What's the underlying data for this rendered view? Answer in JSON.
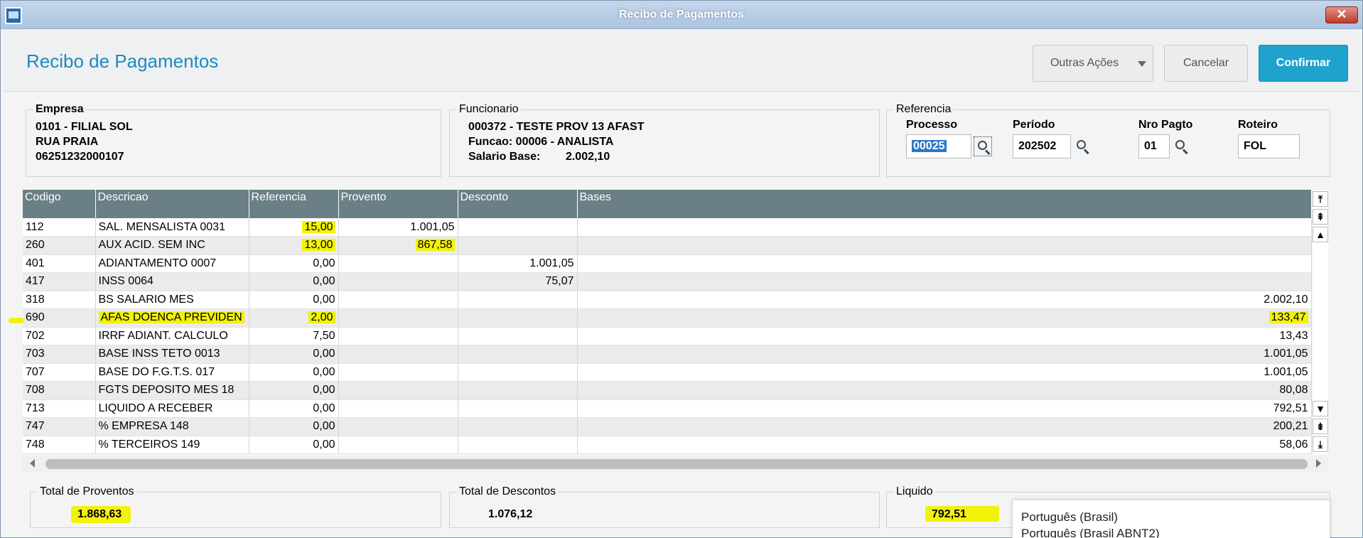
{
  "window": {
    "title": "Recibo de Pagamentos",
    "close_label": "✕"
  },
  "header": {
    "page_title": "Recibo de Pagamentos",
    "outras_label": "Outras Ações",
    "cancel_label": "Cancelar",
    "confirm_label": "Confirmar"
  },
  "empresa": {
    "legend": "Empresa",
    "lines": [
      "0101 - FILIAL SOL",
      "RUA PRAIA",
      "06251232000107"
    ]
  },
  "funcionario": {
    "legend": "Funcionario",
    "lines": [
      "000372 - TESTE PROV 13 AFAST",
      "Funcao: 00006 - ANALISTA",
      "Salario Base:        2.002,10"
    ]
  },
  "referencia": {
    "legend": "Referencia",
    "processo": {
      "label": "Processo",
      "value": "00025"
    },
    "periodo": {
      "label": "Período",
      "value": "202502"
    },
    "nro_pagto": {
      "label": "Nro Pagto",
      "value": "01"
    },
    "roteiro": {
      "label": "Roteiro",
      "value": "FOL"
    }
  },
  "table": {
    "columns": [
      "Codigo",
      "Descricao",
      "Referencia",
      "Provento",
      "Desconto",
      "Bases"
    ],
    "rows": [
      {
        "codigo": "112",
        "descricao": "SAL. MENSALISTA 0031",
        "referencia": "15,00",
        "provento": "1.001,05",
        "desconto": "",
        "bases": ""
      },
      {
        "codigo": "260",
        "descricao": "AUX ACID. SEM INC",
        "referencia": "13,00",
        "provento": "867,58",
        "desconto": "",
        "bases": ""
      },
      {
        "codigo": "401",
        "descricao": "ADIANTAMENTO 0007",
        "referencia": "0,00",
        "provento": "",
        "desconto": "1.001,05",
        "bases": ""
      },
      {
        "codigo": "417",
        "descricao": "INSS 0064",
        "referencia": "0,00",
        "provento": "",
        "desconto": "75,07",
        "bases": ""
      },
      {
        "codigo": "318",
        "descricao": "BS SALARIO MES",
        "referencia": "0,00",
        "provento": "",
        "desconto": "",
        "bases": "2.002,10"
      },
      {
        "codigo": "690",
        "descricao": "AFAS DOENCA PREVIDEN",
        "referencia": "2,00",
        "provento": "",
        "desconto": "",
        "bases": "133,47"
      },
      {
        "codigo": "702",
        "descricao": "IRRF ADIANT. CALCULO",
        "referencia": "7,50",
        "provento": "",
        "desconto": "",
        "bases": "13,43"
      },
      {
        "codigo": "703",
        "descricao": "BASE INSS TETO 0013",
        "referencia": "0,00",
        "provento": "",
        "desconto": "",
        "bases": "1.001,05"
      },
      {
        "codigo": "707",
        "descricao": "BASE DO F.G.T.S. 017",
        "referencia": "0,00",
        "provento": "",
        "desconto": "",
        "bases": "1.001,05"
      },
      {
        "codigo": "708",
        "descricao": "FGTS DEPOSITO MES 18",
        "referencia": "0,00",
        "provento": "",
        "desconto": "",
        "bases": "80,08"
      },
      {
        "codigo": "713",
        "descricao": "LIQUIDO A RECEBER",
        "referencia": "0,00",
        "provento": "",
        "desconto": "",
        "bases": "792,51"
      },
      {
        "codigo": "747",
        "descricao": "% EMPRESA  148",
        "referencia": "0,00",
        "provento": "",
        "desconto": "",
        "bases": "200,21"
      },
      {
        "codigo": "748",
        "descricao": "% TERCEIROS 149",
        "referencia": "0,00",
        "provento": "",
        "desconto": "",
        "bases": "58,06"
      }
    ]
  },
  "totals": {
    "proventos": {
      "label": "Total de Proventos",
      "value": "1.868,63"
    },
    "descontos": {
      "label": "Total de Descontos",
      "value": "1.076,12"
    },
    "liquido": {
      "label": "Liquido",
      "value": "792,51"
    }
  },
  "language_popup": {
    "options": [
      "Português (Brasil)",
      "Português (Brasil ABNT2)"
    ]
  },
  "highlight_color": "#f2f20a",
  "accent_color": "#1fa2cd"
}
